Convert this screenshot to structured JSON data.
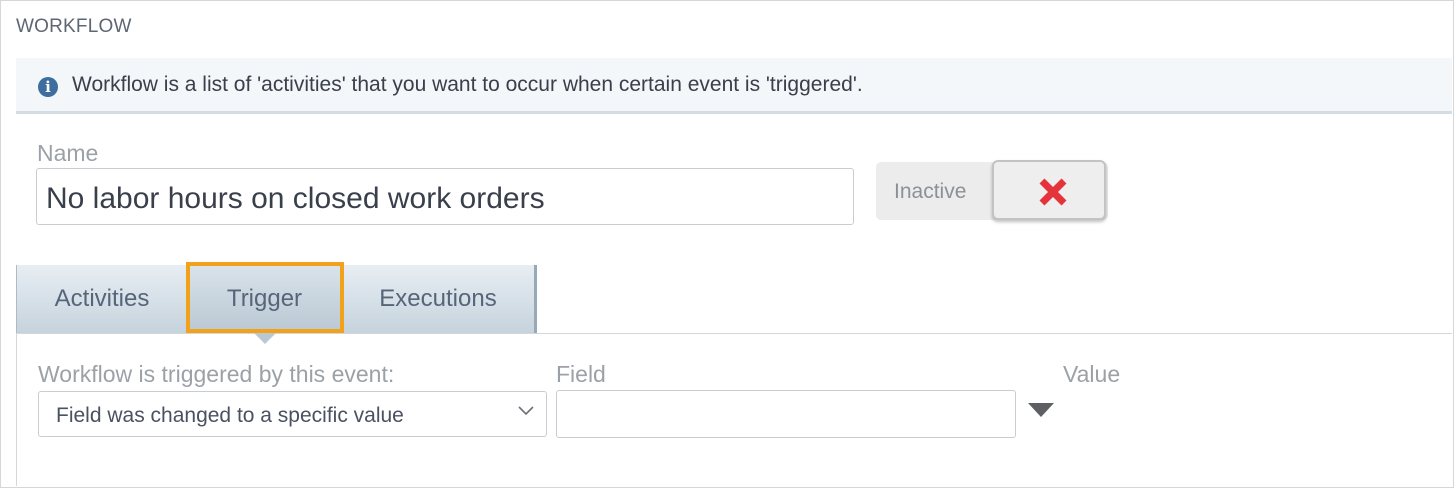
{
  "section": {
    "title": "WORKFLOW"
  },
  "info": {
    "icon": "info-icon",
    "text": "Workflow is a list of 'activities' that you want to occur when certain event is 'triggered'."
  },
  "name": {
    "label": "Name",
    "value": "No labor hours on closed work orders"
  },
  "status_toggle": {
    "label": "Inactive",
    "icon": "close-icon",
    "icon_color": "#e4333a"
  },
  "tabs": [
    {
      "label": "Activities"
    },
    {
      "label": "Trigger",
      "active": true
    },
    {
      "label": "Executions"
    }
  ],
  "trigger": {
    "event_label": "Workflow is triggered by this event:",
    "event_value": "Field was changed to a specific value",
    "field_label": "Field",
    "field_value": "",
    "value_label": "Value"
  },
  "colors": {
    "highlight": "#f2a21a",
    "info_icon": "#3d6e9e"
  }
}
